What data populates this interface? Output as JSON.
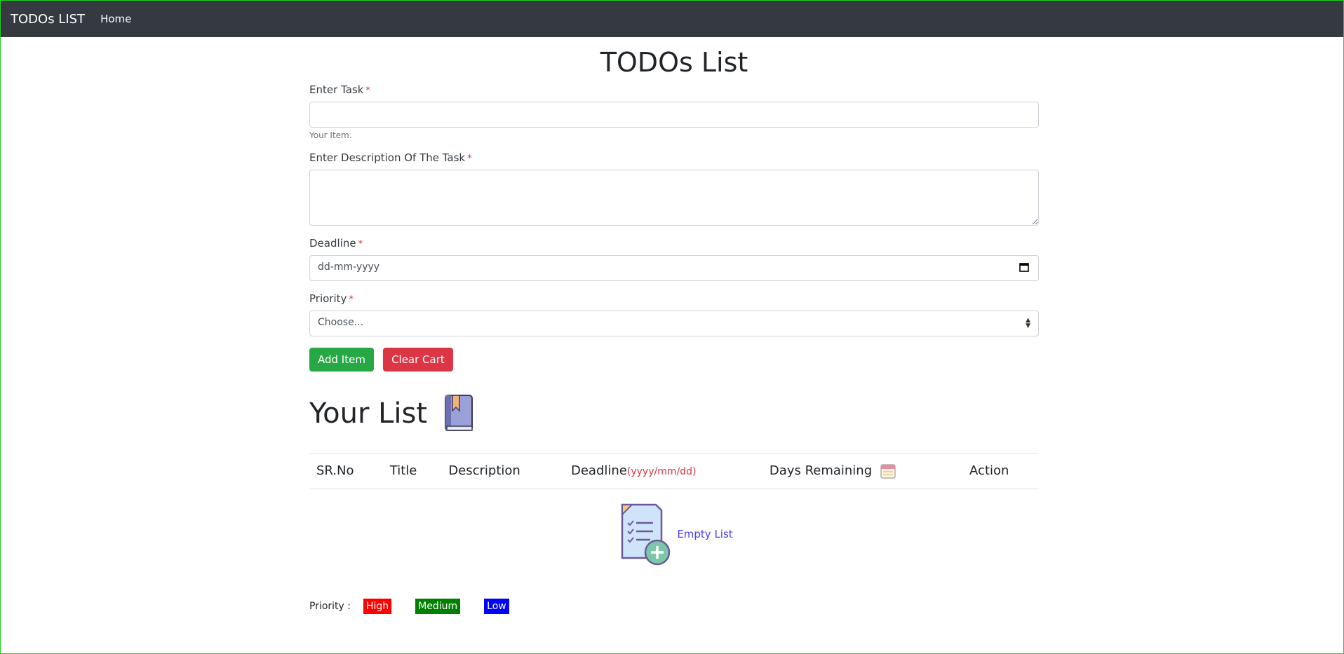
{
  "navbar": {
    "brand": "TODOs LIST",
    "home": "Home"
  },
  "main": {
    "title": "TODOs List",
    "task_label": "Enter Task",
    "task_help": "Your Item.",
    "description_label": "Enter Description Of The Task",
    "deadline_label": "Deadline",
    "deadline_placeholder": "dd-mm-yyyy",
    "priority_label": "Priority",
    "priority_selected": "Choose...",
    "required_mark": "*",
    "add_button": "Add Item",
    "clear_button": "Clear Cart"
  },
  "list": {
    "heading": "Your List",
    "columns": {
      "srno": "SR.No",
      "title": "Title",
      "description": "Description",
      "deadline": "Deadline",
      "deadline_format": "(yyyy/mm/dd)",
      "days_remaining": "Days Remaining",
      "action": "Action"
    },
    "empty_text": "Empty List"
  },
  "legend": {
    "label": "Priority :",
    "high": "High",
    "medium": "Medium",
    "low": "Low"
  },
  "colors": {
    "navbar": "#343a40",
    "add_button": "#28a745",
    "clear_button": "#dc3545",
    "high": "#ff0000",
    "medium": "#008000",
    "low": "#0000ff"
  }
}
